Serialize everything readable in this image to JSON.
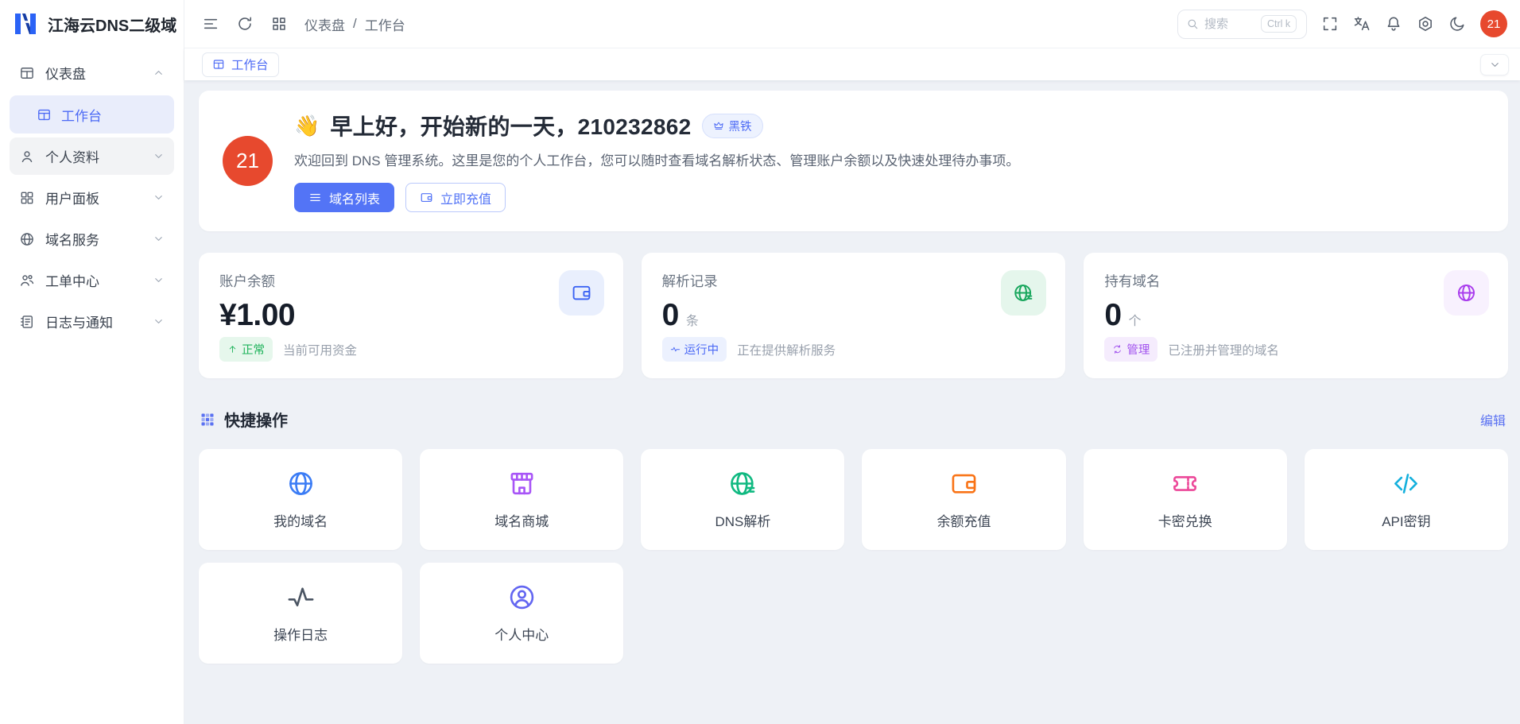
{
  "app": {
    "title": "江海云DNS二级域"
  },
  "sidebar": {
    "items": [
      {
        "label": "仪表盘",
        "icon": "dashboard",
        "expanded": true,
        "state": "normal",
        "children": [
          {
            "label": "工作台",
            "icon": "dashboard",
            "active": true
          }
        ]
      },
      {
        "label": "个人资料",
        "icon": "user",
        "expanded": false,
        "state": "hovered",
        "children": []
      },
      {
        "label": "用户面板",
        "icon": "grid2",
        "expanded": false,
        "state": "normal",
        "children": []
      },
      {
        "label": "域名服务",
        "icon": "globe",
        "expanded": false,
        "state": "normal",
        "children": []
      },
      {
        "label": "工单中心",
        "icon": "users",
        "expanded": false,
        "state": "normal",
        "children": []
      },
      {
        "label": "日志与通知",
        "icon": "log",
        "expanded": false,
        "state": "normal",
        "children": []
      }
    ]
  },
  "header": {
    "left_icons": [
      "menu-fold",
      "refresh",
      "apps"
    ],
    "breadcrumb": {
      "parent": "仪表盘",
      "separator": "/",
      "current": "工作台"
    },
    "search": {
      "placeholder": "搜索",
      "shortcut": "Ctrl k"
    },
    "right_icons": [
      "fullscreen",
      "translate",
      "bell",
      "settings",
      "moon"
    ],
    "avatar": "21"
  },
  "tabbar": {
    "active_tab": "工作台"
  },
  "welcome": {
    "avatar": "21",
    "emoji": "👋",
    "title": "早上好，开始新的一天，210232862",
    "badge": "黑铁",
    "subtitle": "欢迎回到 DNS 管理系统。这里是您的个人工作台，您可以随时查看域名解析状态、管理账户余额以及快速处理待办事项。",
    "buttons": [
      {
        "label": "域名列表",
        "icon": "list",
        "style": "primary"
      },
      {
        "label": "立即充值",
        "icon": "wallet",
        "style": "outline"
      }
    ]
  },
  "stats": [
    {
      "label": "账户余额",
      "value": "¥1.00",
      "unit": "",
      "badge": {
        "label": "正常",
        "icon": "arrow-up",
        "variant": "green"
      },
      "desc": "当前可用资金",
      "icon": "wallet",
      "variant": "blue"
    },
    {
      "label": "解析记录",
      "value": "0",
      "unit": "条",
      "badge": {
        "label": "运行中",
        "icon": "pulse",
        "variant": "blue"
      },
      "desc": "正在提供解析服务",
      "icon": "globe-dns",
      "variant": "green"
    },
    {
      "label": "持有域名",
      "value": "0",
      "unit": "个",
      "badge": {
        "label": "管理",
        "icon": "sync",
        "variant": "purple"
      },
      "desc": "已注册并管理的域名",
      "icon": "globe",
      "variant": "purple"
    }
  ],
  "quick_actions": {
    "title": "快捷操作",
    "edit_label": "编辑",
    "items": [
      {
        "label": "我的域名",
        "icon": "globe",
        "color": "#3b7cf5"
      },
      {
        "label": "域名商城",
        "icon": "store",
        "color": "#a855f7"
      },
      {
        "label": "DNS解析",
        "icon": "globe-dns",
        "color": "#10b981"
      },
      {
        "label": "余额充值",
        "icon": "wallet",
        "color": "#f97316"
      },
      {
        "label": "卡密兑换",
        "icon": "ticket",
        "color": "#ec4899"
      },
      {
        "label": "API密钥",
        "icon": "code",
        "color": "#14b0dd"
      },
      {
        "label": "操作日志",
        "icon": "activity",
        "color": "#4b5563"
      },
      {
        "label": "个人中心",
        "icon": "user-circle",
        "color": "#6366f1"
      }
    ]
  },
  "colors": {
    "primary": "#5374f6",
    "avatar": "#e7492e",
    "page_bg": "#eef1f6",
    "badge_green": "#1fb35b",
    "badge_blue": "#4c6af5",
    "badge_purple": "#a254ee"
  }
}
